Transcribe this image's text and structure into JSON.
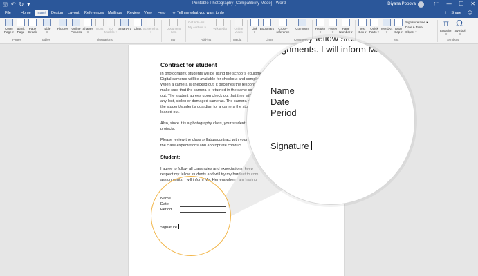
{
  "titlebar": {
    "qat": {
      "save": "🖫",
      "undo": "↶",
      "redo": "↻",
      "more": "▾"
    },
    "doc_title": "Printable Photography [Compatibility Mode] - Word",
    "user": "Diyana Popova",
    "window_controls": {
      "ribbon_display": "⬚",
      "minimize": "—",
      "maximize": "☐",
      "close": "✕"
    }
  },
  "tabs": [
    "File",
    "Home",
    "Insert",
    "Design",
    "Layout",
    "References",
    "Mailings",
    "Review",
    "View",
    "Help"
  ],
  "tellme": "Tell me what you want to do",
  "share": "Share",
  "ribbon": {
    "buttons": [
      {
        "label": "Cover\nPage ▾"
      },
      {
        "label": "Blank\nPage"
      },
      {
        "label": "Page\nBreak"
      },
      {
        "label": "Table\n▾"
      },
      {
        "label": "Pictures"
      },
      {
        "label": "Online\nPictures"
      },
      {
        "label": "Shapes\n▾"
      },
      {
        "label": "Icons"
      },
      {
        "label": "3D\nModels ▾"
      },
      {
        "label": "SmartArt"
      },
      {
        "label": "Chart"
      },
      {
        "label": "Screenshot\n▾"
      },
      {
        "label": "Document\nItem"
      },
      {
        "label": "Wikipedia"
      },
      {
        "label": "Online\nVideo"
      },
      {
        "label": "Link\n▾"
      },
      {
        "label": "Bookmark"
      },
      {
        "label": "Cross-\nreference"
      },
      {
        "label": "Comment"
      },
      {
        "label": "Header\n▾"
      },
      {
        "label": "Footer\n▾"
      },
      {
        "label": "Page\nNumber ▾"
      },
      {
        "label": "Text\nBox ▾"
      },
      {
        "label": "Quick\nParts ▾"
      },
      {
        "label": "WordArt\n▾"
      },
      {
        "label": "Drop\nCap ▾"
      },
      {
        "label": "Equation\n▾"
      },
      {
        "label": "Symbol\n▾"
      }
    ],
    "addins": [
      "Get Add-ins",
      "My Add-ins ▾"
    ],
    "text_small": [
      "Signature Line ▾",
      "Date & Time",
      "Object ▾"
    ],
    "groups": [
      "Pages",
      "Tables",
      "Illustrations",
      "Tap",
      "Add-ins",
      "Media",
      "Links",
      "Comments",
      "Header & Footer",
      "Text",
      "Symbols"
    ]
  },
  "document": {
    "title": "Contract for student",
    "para1": [
      "In photography, students will be using the school's equipment.",
      "Digital cameras will be available for checkout and completion of",
      "When a camera is checked out, it becomes the responsibility of",
      "make sure that the camera is returned in the same condition it was",
      "out. The student agrees upon check out that they will be responsible",
      "any lost, stolen or damaged cameras. The camera checkout requires",
      "the student/student's guardian for a camera the student has",
      "loaned out."
    ],
    "para2": [
      "Also, since it is a photography class, your student will",
      "projects."
    ],
    "para3": [
      "Please review the class syllabus/contract with your student",
      "the class expectations and appropriate conduct."
    ],
    "student_heading": "Student:",
    "para4": [
      "I agree to follow all class rules and expectations, keep",
      "respect my fellow students and will try my hardest to com",
      "assignments. I will inform Ms. Herrera when I am having"
    ],
    "fields": [
      "Name",
      "Date",
      "Period"
    ],
    "signature": "Signature"
  },
  "magnifier": {
    "top_line1": "my fellow stud",
    "top_line2": "ssignments. I will inform Ms.",
    "fields": [
      "Name",
      "Date",
      "Period"
    ],
    "signature": "Signature"
  },
  "colors": {
    "accent": "#2b579a",
    "highlight_circle": "#f2b64a"
  }
}
